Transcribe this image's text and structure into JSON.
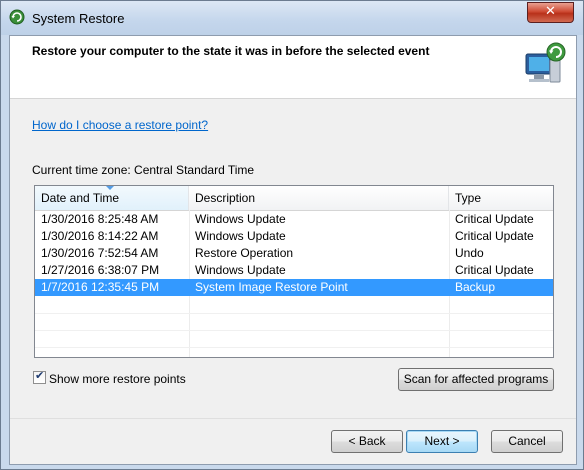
{
  "window": {
    "title": "System Restore",
    "close_glyph": "✕"
  },
  "header": {
    "title": "Restore your computer to the state it was in before the selected event",
    "icon": "restore-computer-icon"
  },
  "help_link": "How do I choose a restore point?",
  "timezone": "Current time zone: Central Standard Time",
  "list": {
    "columns": [
      "Date and Time",
      "Description",
      "Type"
    ],
    "rows": [
      {
        "date": "1/30/2016 8:25:48 AM",
        "description": "Windows Update",
        "type": "Critical Update",
        "selected": false
      },
      {
        "date": "1/30/2016 8:14:22 AM",
        "description": "Windows Update",
        "type": "Critical Update",
        "selected": false
      },
      {
        "date": "1/30/2016 7:52:54 AM",
        "description": "Restore Operation",
        "type": "Undo",
        "selected": false
      },
      {
        "date": "1/27/2016 6:38:07 PM",
        "description": "Windows Update",
        "type": "Critical Update",
        "selected": false
      },
      {
        "date": "1/7/2016 12:35:45 PM",
        "description": "System Image Restore Point",
        "type": "Backup",
        "selected": true
      }
    ]
  },
  "show_more": {
    "label": "Show more restore points",
    "checked": true,
    "check_glyph": "✔"
  },
  "buttons": {
    "scan": "Scan for affected programs",
    "back": "< Back",
    "next": "Next >",
    "cancel": "Cancel"
  },
  "colors": {
    "selection": "#3399ff",
    "link": "#0066cc",
    "close": "#c7432e"
  }
}
